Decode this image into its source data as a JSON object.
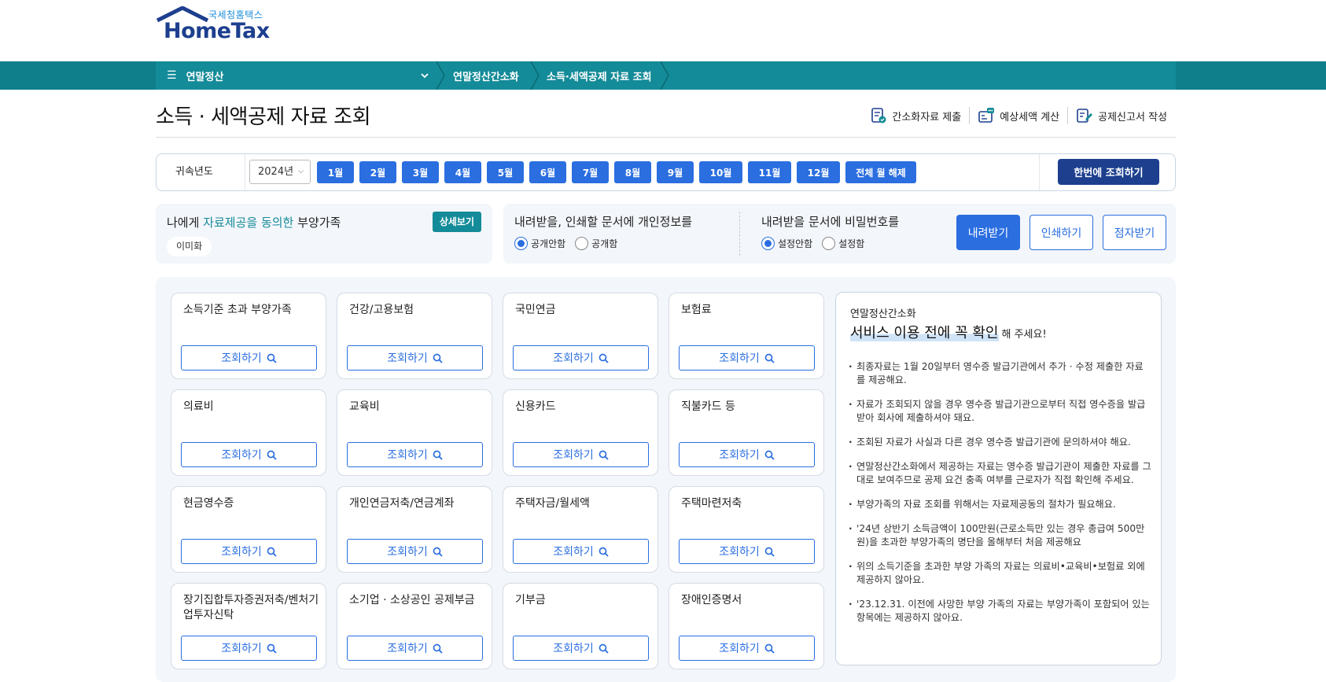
{
  "logo": {
    "korean": "국세청홈택스",
    "english": "HomeTax"
  },
  "nav": {
    "menu_label": "연말정산",
    "crumbs": [
      "연말정산간소화",
      "소득·세액공제 자료 조회"
    ]
  },
  "page": {
    "title": "소득 · 세액공제 자료 조회",
    "quick_links": [
      "간소화자료 제출",
      "예상세액 계산",
      "공제신고서 작성"
    ]
  },
  "filter": {
    "label": "귀속년도",
    "year": "2024년",
    "months": [
      "1월",
      "2월",
      "3월",
      "4월",
      "5월",
      "6월",
      "7월",
      "8월",
      "9월",
      "10월",
      "11월",
      "12월"
    ],
    "clear_all": "전체 월 해제",
    "search_all": "한번에 조회하기"
  },
  "dependents": {
    "title_pre": "나에게 ",
    "title_hl": "자료제공을 동의한",
    "title_post": " 부양가족",
    "detail_button": "상세보기",
    "chip": "이미화"
  },
  "options": {
    "privacy_title": "내려받을, 인쇄할 문서에 개인정보를",
    "privacy_opts": [
      "공개안함",
      "공개함"
    ],
    "privacy_selected": "공개안함",
    "password_title": "내려받을 문서에 비밀번호를",
    "password_opts": [
      "설정안함",
      "설정함"
    ],
    "password_selected": "설정안함",
    "buttons": [
      "내려받기",
      "인쇄하기",
      "점자받기"
    ]
  },
  "cards": {
    "button_label": "조회하기",
    "items": [
      {
        "title": "소득기준 초과 부양가족"
      },
      {
        "title": "건강/고용보험"
      },
      {
        "title": "국민연금"
      },
      {
        "title": "보험료"
      },
      {
        "title": "의료비"
      },
      {
        "title": "교육비"
      },
      {
        "title": "신용카드"
      },
      {
        "title": "직불카드 등"
      },
      {
        "title": "현금영수증"
      },
      {
        "title": "개인연금저축/연금계좌"
      },
      {
        "title": "주택자금/월세액"
      },
      {
        "title": "주택마련저축"
      },
      {
        "title": "장기집합투자증권저축/벤처기업투자신탁"
      },
      {
        "title": "소기업 · 소상공인 공제부금"
      },
      {
        "title": "기부금"
      },
      {
        "title": "장애인증명서"
      }
    ]
  },
  "notice": {
    "small": "연말정산간소화",
    "big": "서비스 이용 전에 꼭 확인",
    "big_suffix": "해 주세요!",
    "items": [
      "최종자료는 1월 20일부터 영수증 발급기관에서 추가 · 수정 제출한 자료를 제공해요.",
      "자료가 조회되지 않을 경우 영수증 발급기관으로부터 직접 영수증을 발급받아 회사에 제출하셔야 돼요.",
      "조회된 자료가 사실과 다른 경우 영수증 발급기관에 문의하셔야 해요.",
      "연말정산간소화에서 제공하는 자료는 영수증 발급기관이 제출한 자료를 그대로 보여주므로 공제 요건 충족 여부를 근로자가 직접 확인해 주세요.",
      "부양가족의 자료 조회를 위해서는 자료제공동의 절차가 필요해요.",
      "'24년 상반기 소득금액이 100만원(근로소득만 있는 경우 총급여 500만원)을 초과한 부양가족의 명단을 올해부터 처음 제공해요",
      "위의 소득기준을 초과한 부양 가족의 자료는 의료비•교육비•보험료 외에 제공하지 않아요.",
      "'23.12.31. 이전에 사망한 부양 가족의 자료는 부양가족이 포함되어 있는 항목에는 제공하지 않아요."
    ]
  },
  "colors": {
    "teal": "#148b98",
    "blue": "#2a6ee0",
    "navy": "#1d3f8e"
  }
}
